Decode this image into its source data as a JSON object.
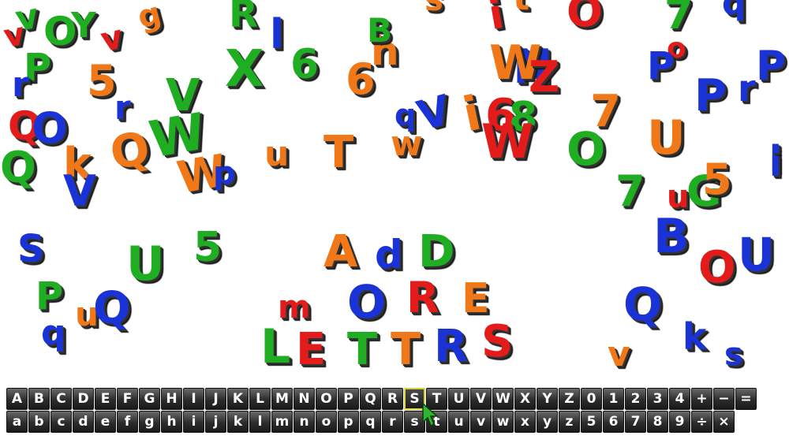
{
  "colors": {
    "red": "#e41b1b",
    "green": "#1fae22",
    "blue": "#1a33d6",
    "orange": "#f07818",
    "key_bg": "#2a2a2a",
    "key_text": "#ffffff",
    "key_selected_border": "#d8d23a",
    "cursor": "#2fb52f"
  },
  "keyboard": {
    "selected_key": "S",
    "row1": [
      "A",
      "B",
      "C",
      "D",
      "E",
      "F",
      "G",
      "H",
      "I",
      "J",
      "K",
      "L",
      "M",
      "N",
      "O",
      "P",
      "Q",
      "R",
      "S",
      "T",
      "U",
      "V",
      "W",
      "X",
      "Y",
      "Z",
      "0",
      "1",
      "2",
      "3",
      "4",
      "+",
      "−",
      "="
    ],
    "row2": [
      "a",
      "b",
      "c",
      "d",
      "e",
      "f",
      "g",
      "h",
      "i",
      "j",
      "k",
      "l",
      "m",
      "n",
      "o",
      "p",
      "q",
      "r",
      "s",
      "t",
      "u",
      "v",
      "w",
      "x",
      "y",
      "z",
      "5",
      "6",
      "7",
      "8",
      "9",
      "÷",
      "×"
    ]
  },
  "letters": [
    {
      "t": "v",
      "c": "green"
    },
    {
      "t": "P",
      "c": "green"
    },
    {
      "t": "O",
      "c": "green"
    },
    {
      "t": "Y",
      "c": "green"
    },
    {
      "t": "g",
      "c": "orange"
    },
    {
      "t": "v",
      "c": "red"
    },
    {
      "t": "v",
      "c": "red"
    },
    {
      "t": "R",
      "c": "green"
    },
    {
      "t": "l",
      "c": "blue"
    },
    {
      "t": "X",
      "c": "green"
    },
    {
      "t": "6",
      "c": "green"
    },
    {
      "t": "s",
      "c": "orange"
    },
    {
      "t": "h",
      "c": "orange"
    },
    {
      "t": "B",
      "c": "green"
    },
    {
      "t": "6",
      "c": "orange"
    },
    {
      "t": "i",
      "c": "red"
    },
    {
      "t": "t",
      "c": "orange"
    },
    {
      "t": "O",
      "c": "red"
    },
    {
      "t": "7",
      "c": "green"
    },
    {
      "t": "o",
      "c": "red"
    },
    {
      "t": "P",
      "c": "blue"
    },
    {
      "t": "q",
      "c": "blue"
    },
    {
      "t": "P",
      "c": "blue"
    },
    {
      "t": "r",
      "c": "blue"
    },
    {
      "t": "P",
      "c": "blue"
    },
    {
      "t": "i",
      "c": "blue"
    },
    {
      "t": "r",
      "c": "blue"
    },
    {
      "t": "5",
      "c": "orange"
    },
    {
      "t": "r",
      "c": "blue"
    },
    {
      "t": "V",
      "c": "green"
    },
    {
      "t": "Q",
      "c": "red"
    },
    {
      "t": "O",
      "c": "blue"
    },
    {
      "t": "Q",
      "c": "green"
    },
    {
      "t": "k",
      "c": "orange"
    },
    {
      "t": "V",
      "c": "blue"
    },
    {
      "t": "Q",
      "c": "orange"
    },
    {
      "t": "W",
      "c": "green"
    },
    {
      "t": "W",
      "c": "orange"
    },
    {
      "t": "p",
      "c": "blue"
    },
    {
      "t": "u",
      "c": "orange"
    },
    {
      "t": "T",
      "c": "orange"
    },
    {
      "t": "w",
      "c": "orange"
    },
    {
      "t": "q",
      "c": "blue"
    },
    {
      "t": "V",
      "c": "blue"
    },
    {
      "t": "i",
      "c": "orange"
    },
    {
      "t": "N",
      "c": "blue"
    },
    {
      "t": "W",
      "c": "orange"
    },
    {
      "t": "Z",
      "c": "red"
    },
    {
      "t": "6",
      "c": "red"
    },
    {
      "t": "8",
      "c": "green"
    },
    {
      "t": "W",
      "c": "red"
    },
    {
      "t": "7",
      "c": "orange"
    },
    {
      "t": "O",
      "c": "green"
    },
    {
      "t": "U",
      "c": "orange"
    },
    {
      "t": "7",
      "c": "green"
    },
    {
      "t": "u",
      "c": "red"
    },
    {
      "t": "G",
      "c": "green"
    },
    {
      "t": "5",
      "c": "orange"
    },
    {
      "t": "i",
      "c": "blue"
    },
    {
      "t": "S",
      "c": "blue"
    },
    {
      "t": "P",
      "c": "green"
    },
    {
      "t": "U",
      "c": "green"
    },
    {
      "t": "5",
      "c": "green"
    },
    {
      "t": "u",
      "c": "orange"
    },
    {
      "t": "Q",
      "c": "blue"
    },
    {
      "t": "q",
      "c": "blue"
    },
    {
      "t": "A",
      "c": "orange"
    },
    {
      "t": "d",
      "c": "blue"
    },
    {
      "t": "D",
      "c": "green"
    },
    {
      "t": "m",
      "c": "red"
    },
    {
      "t": "O",
      "c": "blue"
    },
    {
      "t": "R",
      "c": "red"
    },
    {
      "t": "E",
      "c": "orange"
    },
    {
      "t": "L",
      "c": "green"
    },
    {
      "t": "E",
      "c": "red"
    },
    {
      "t": "T",
      "c": "green"
    },
    {
      "t": "T",
      "c": "orange"
    },
    {
      "t": "R",
      "c": "blue"
    },
    {
      "t": "S",
      "c": "red"
    },
    {
      "t": "B",
      "c": "blue"
    },
    {
      "t": "O",
      "c": "red"
    },
    {
      "t": "U",
      "c": "blue"
    },
    {
      "t": "Q",
      "c": "blue"
    },
    {
      "t": "k",
      "c": "blue"
    },
    {
      "t": "v",
      "c": "orange"
    },
    {
      "t": "s",
      "c": "blue"
    }
  ]
}
